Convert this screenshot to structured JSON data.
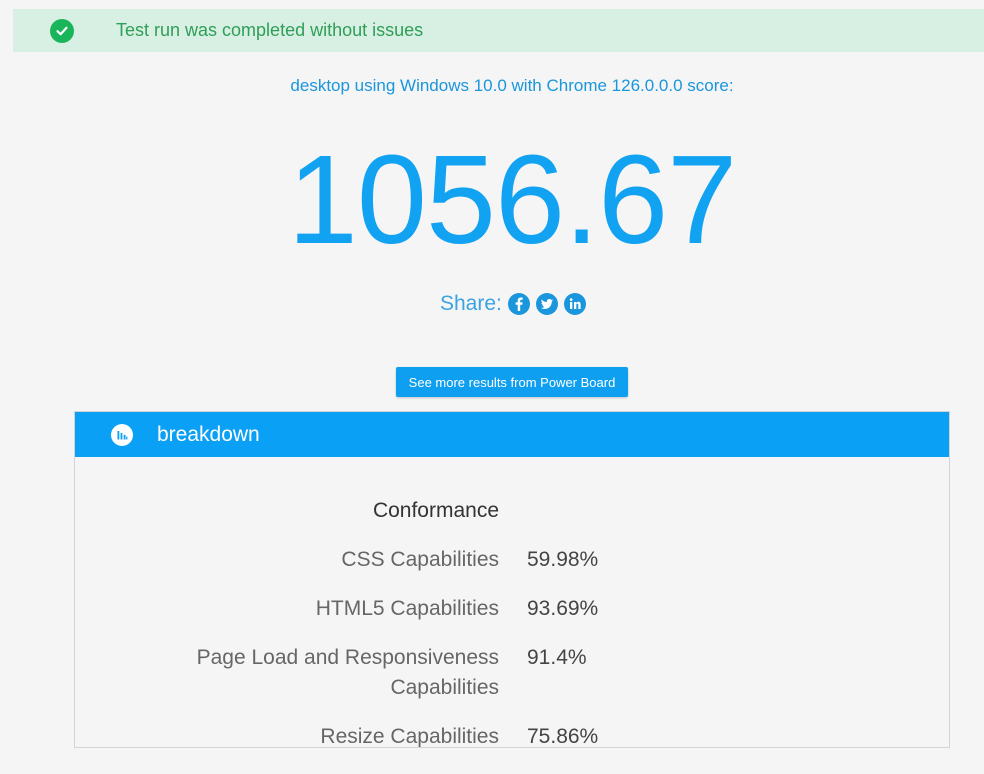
{
  "alert": {
    "text": "Test run was completed without issues",
    "icon": "check-circle-icon",
    "color": "#1ab45a"
  },
  "result": {
    "device_line": "desktop using Windows 10.0 with Chrome 126.0.0.0 score:",
    "score": "1056.67",
    "accent_color": "#12a2f2"
  },
  "share": {
    "label": "Share:",
    "icons": [
      "facebook-icon",
      "twitter-icon",
      "linkedin-icon"
    ]
  },
  "more_button": {
    "label": "See more results from Power Board"
  },
  "panel": {
    "title": "breakdown",
    "icon": "bar-chart-icon",
    "section_heading": "Conformance",
    "rows": [
      {
        "label": "CSS Capabilities",
        "value": "59.98%"
      },
      {
        "label": "HTML5 Capabilities",
        "value": "93.69%"
      },
      {
        "label": "Page Load and Responsiveness Capabilities",
        "value": "91.4%"
      },
      {
        "label": "Resize Capabilities",
        "value": "75.86%"
      }
    ]
  }
}
